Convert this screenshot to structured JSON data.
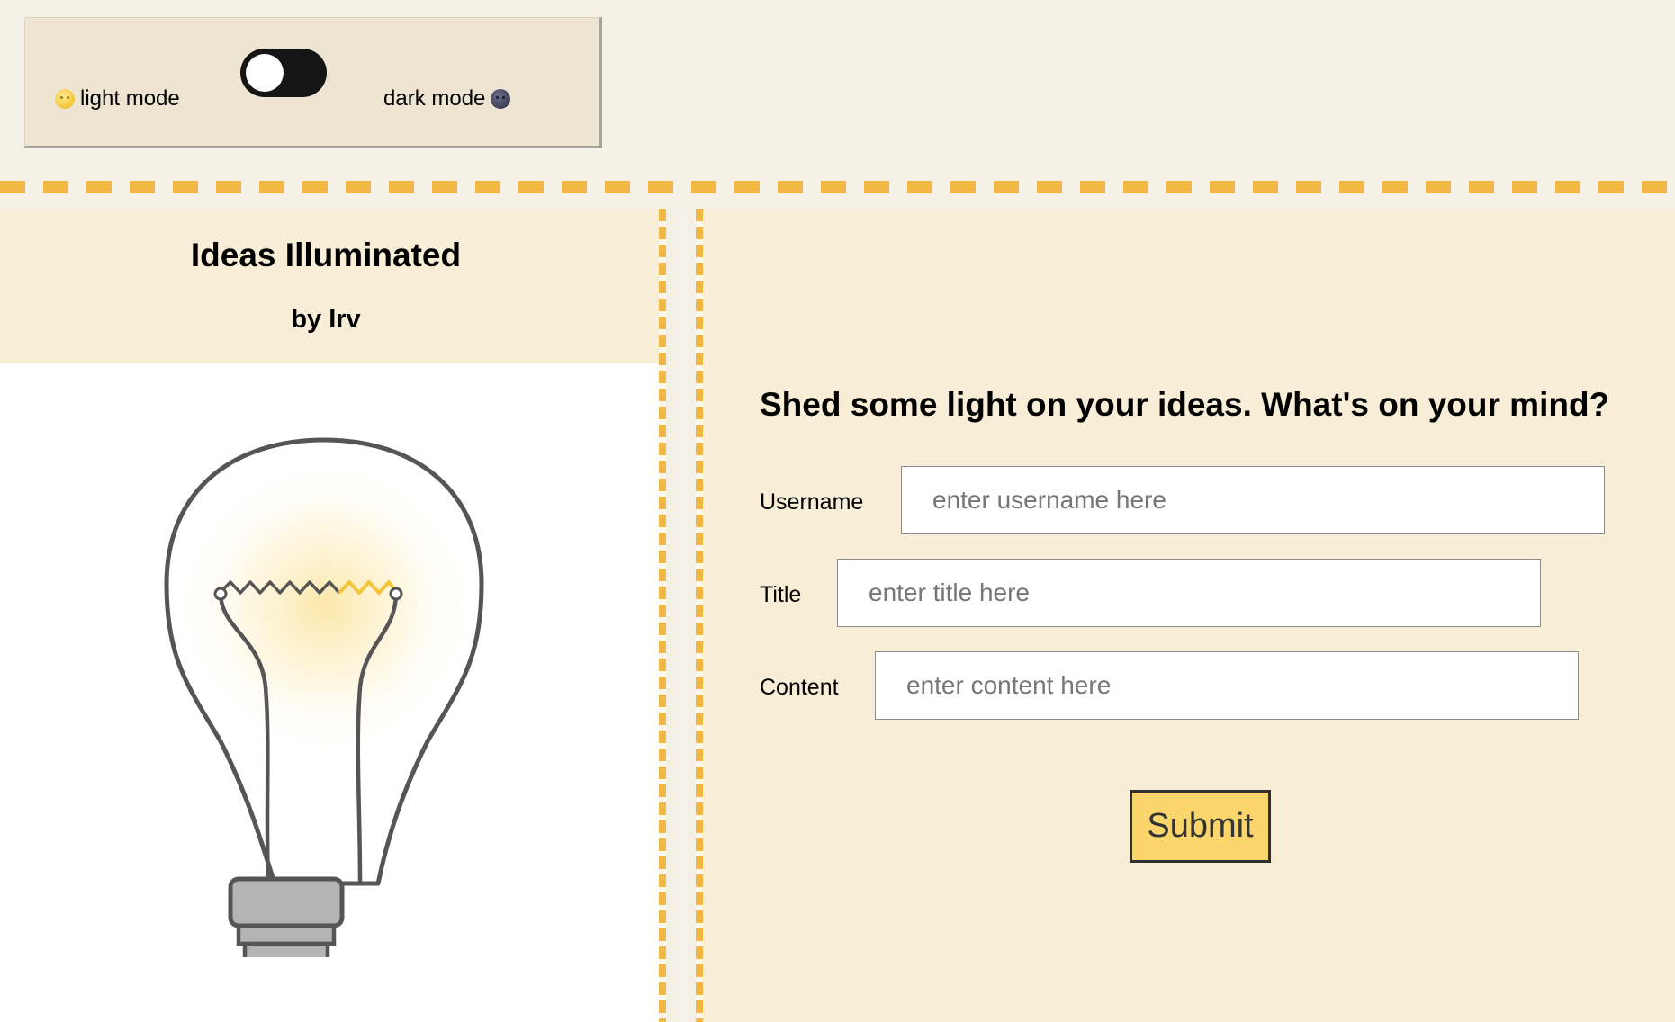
{
  "mode_toggle": {
    "light_label": "light mode",
    "dark_label": "dark mode",
    "state": "light"
  },
  "blog": {
    "title": "Ideas Illuminated",
    "author": "by Irv"
  },
  "form": {
    "prompt": "Shed some light on your ideas. What's on your mind?",
    "fields": {
      "username": {
        "label": "Username",
        "placeholder": "enter username here",
        "value": ""
      },
      "title": {
        "label": "Title",
        "placeholder": "enter title here",
        "value": ""
      },
      "content": {
        "label": "Content",
        "placeholder": "enter content here",
        "value": ""
      }
    },
    "submit_label": "Submit"
  },
  "icons": {
    "light": "sun-face-icon",
    "dark": "moon-face-icon",
    "hero": "lightbulb-icon"
  },
  "colors": {
    "page_background": "#f5f1e6",
    "panel_background": "#ede4d2",
    "section_background": "#f8eed8",
    "dash_accent": "#f2b744",
    "toggle_track": "#151515",
    "submit_background": "#fad56b"
  }
}
